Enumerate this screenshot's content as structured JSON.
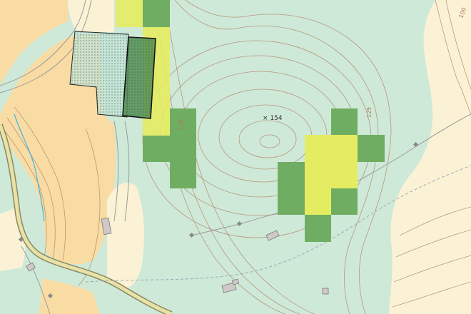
{
  "map": {
    "spot_height_label": "× 154",
    "contour_labels": [
      "125",
      "125",
      "100"
    ],
    "colors": {
      "forest": "#cfe9d8",
      "farmland": "#f9dca4",
      "open_land": "#fbf2d6",
      "grid_dark": "#6fae62",
      "grid_yellow": "#e4ec62",
      "contour": "#b08a6a",
      "water": "#39b6e8",
      "road": "#e9e2a8"
    }
  }
}
